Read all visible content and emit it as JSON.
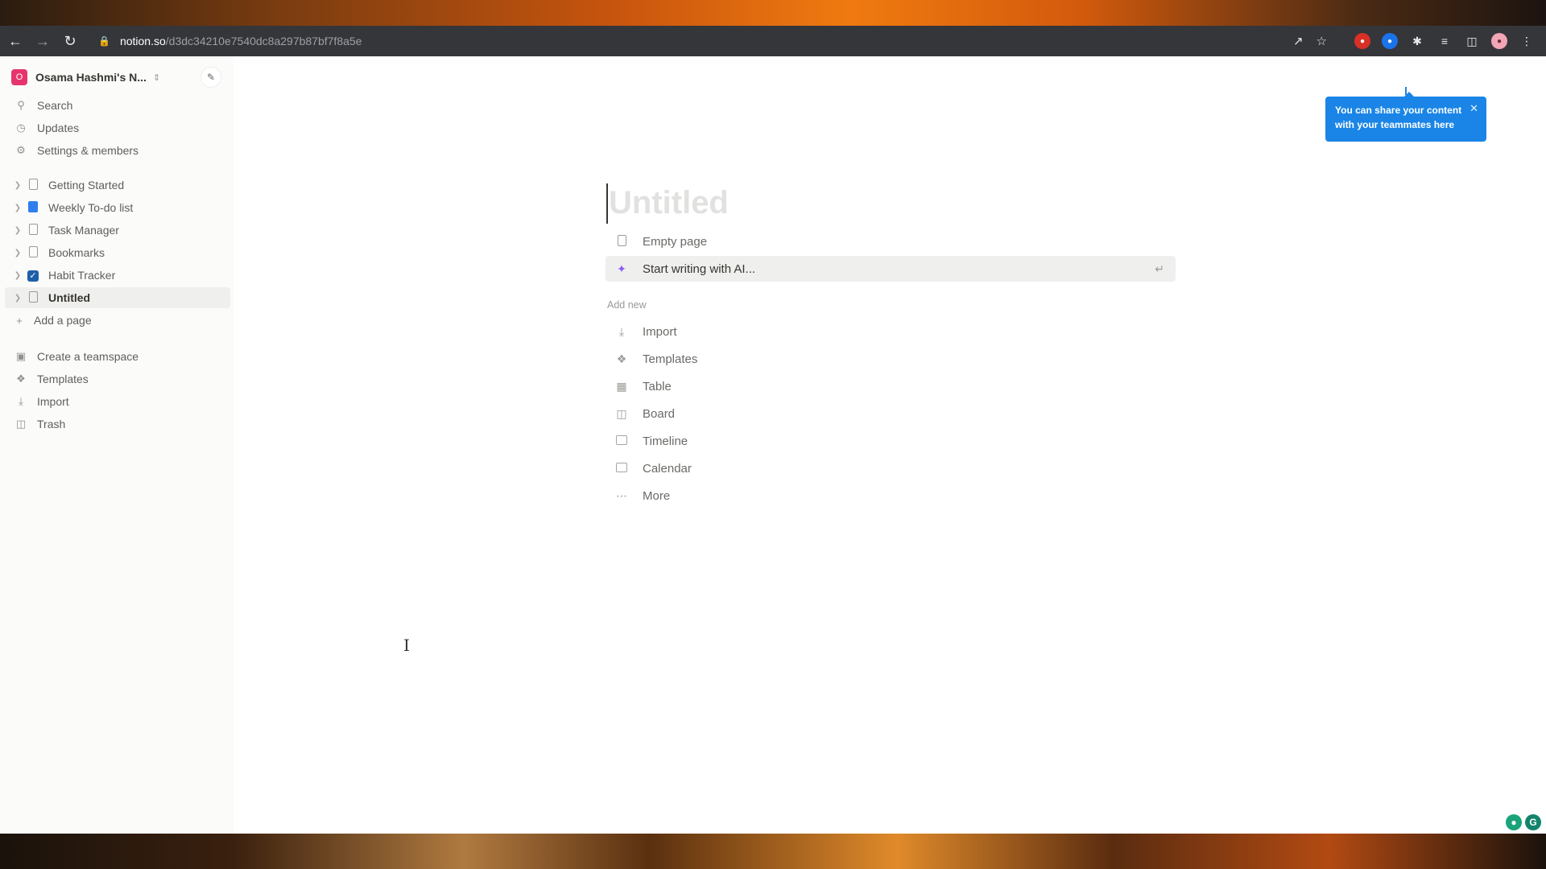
{
  "browser": {
    "url_host": "notion.so",
    "url_path": "/d3dc34210e7540dc8a297b87bf7f8a5e"
  },
  "sidebar": {
    "workspace_name": "Osama Hashmi's N...",
    "workspace_initial": "O",
    "top_items": [
      {
        "label": "Search",
        "icon": "search-icon"
      },
      {
        "label": "Updates",
        "icon": "clock-icon"
      },
      {
        "label": "Settings & members",
        "icon": "gear-icon"
      }
    ],
    "pages": [
      {
        "label": "Getting Started"
      },
      {
        "label": "Weekly To-do list"
      },
      {
        "label": "Task Manager"
      },
      {
        "label": "Bookmarks"
      },
      {
        "label": "Habit Tracker"
      },
      {
        "label": "Untitled"
      }
    ],
    "add_page": "Add a page",
    "bottom_items": [
      {
        "label": "Create a teamspace"
      },
      {
        "label": "Templates"
      },
      {
        "label": "Import"
      },
      {
        "label": "Trash"
      }
    ]
  },
  "main": {
    "title_placeholder": "Untitled",
    "empty_page": "Empty page",
    "ai_prompt": "Start writing with AI...",
    "add_new_label": "Add new",
    "add_new_items": [
      "Import",
      "Templates",
      "Table",
      "Board",
      "Timeline",
      "Calendar",
      "More"
    ]
  },
  "tooltip": {
    "text": "You can share your content with your teammates here"
  },
  "colors": {
    "accent": "#1a85e6",
    "workspace_badge": "#e6356c",
    "sidebar_bg": "#fbfbfa"
  }
}
